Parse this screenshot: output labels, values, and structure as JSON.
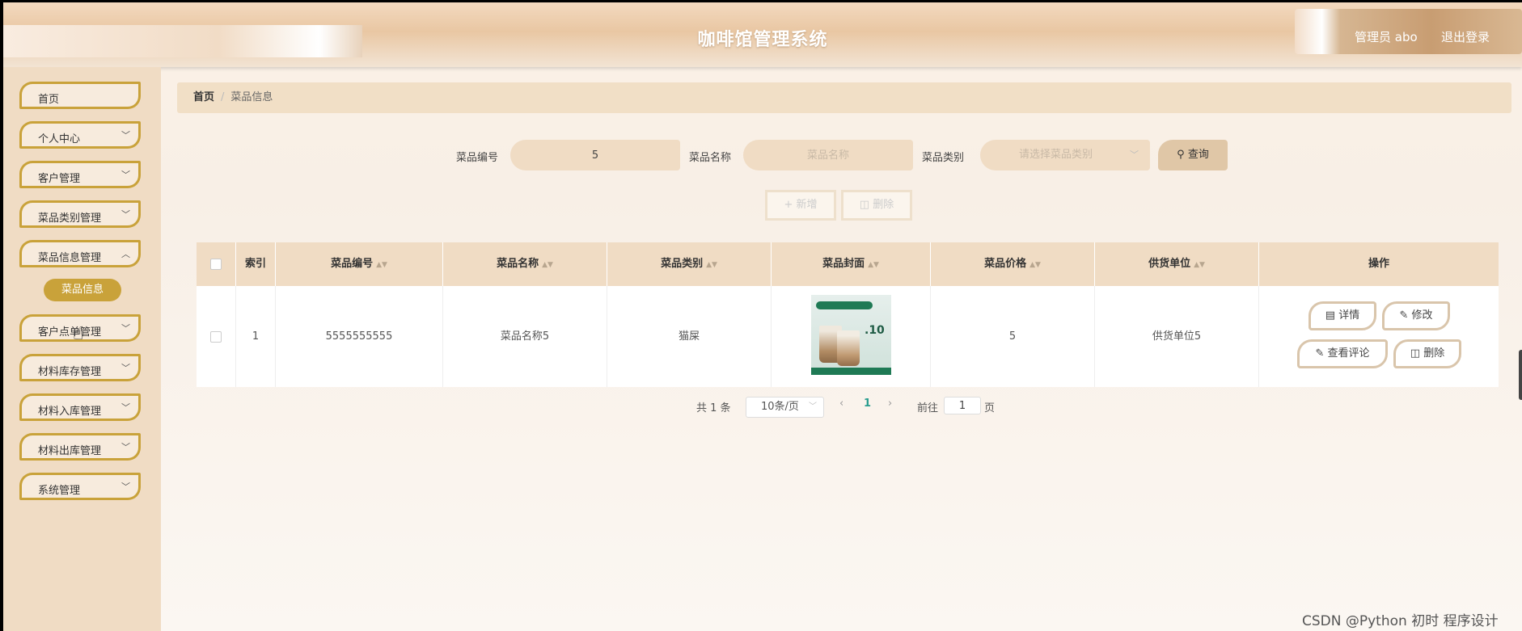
{
  "header": {
    "title": "咖啡馆管理系统",
    "admin": "管理员 abo",
    "logout": "退出登录"
  },
  "sidebar": {
    "items": [
      {
        "label": "首页",
        "chev": ""
      },
      {
        "label": "个人中心",
        "chev": "﹀"
      },
      {
        "label": "客户管理",
        "chev": "﹀"
      },
      {
        "label": "菜品类别管理",
        "chev": "﹀"
      },
      {
        "label": "菜品信息管理",
        "chev": "︿"
      },
      {
        "label": "客户点单管理",
        "chev": "﹀"
      },
      {
        "label": "材料库存管理",
        "chev": "﹀"
      },
      {
        "label": "材料入库管理",
        "chev": "﹀"
      },
      {
        "label": "材料出库管理",
        "chev": "﹀"
      },
      {
        "label": "系统管理",
        "chev": "﹀"
      }
    ],
    "sub_active": "菜品信息"
  },
  "breadcrumb": {
    "home": "首页",
    "sep": "/",
    "current": "菜品信息"
  },
  "filters": {
    "code_label": "菜品编号",
    "code_value": "5",
    "name_label": "菜品名称",
    "name_placeholder": "菜品名称",
    "category_label": "菜品类别",
    "category_placeholder": "请选择菜品类别",
    "search_label": "查询"
  },
  "actions": {
    "add": "新增",
    "delete": "删除"
  },
  "table": {
    "headers": [
      "索引",
      "菜品编号",
      "菜品名称",
      "菜品类别",
      "菜品封面",
      "菜品价格",
      "供货单位",
      "操作"
    ],
    "rows": [
      {
        "index": "1",
        "code": "5555555555",
        "name": "菜品名称5",
        "category": "猫屎",
        "price": "5",
        "supplier": "供货单位5"
      }
    ],
    "row_actions": {
      "detail": "详情",
      "edit": "修改",
      "comments": "查看评论",
      "delete": "删除"
    },
    "cover_text": {
      "price": ".10"
    }
  },
  "pagination": {
    "total": "共 1 条",
    "page_size": "10条/页",
    "current_page": "1",
    "goto_label": "前往",
    "goto_value": "1",
    "page_suffix": "页"
  },
  "watermark": "CSDN @Python 初时 程序设计",
  "colors": {
    "accent": "#c9a23a",
    "header": "#e9c7a3",
    "sidebar": "#f0dcc4",
    "pager": "#2a9d8f"
  }
}
